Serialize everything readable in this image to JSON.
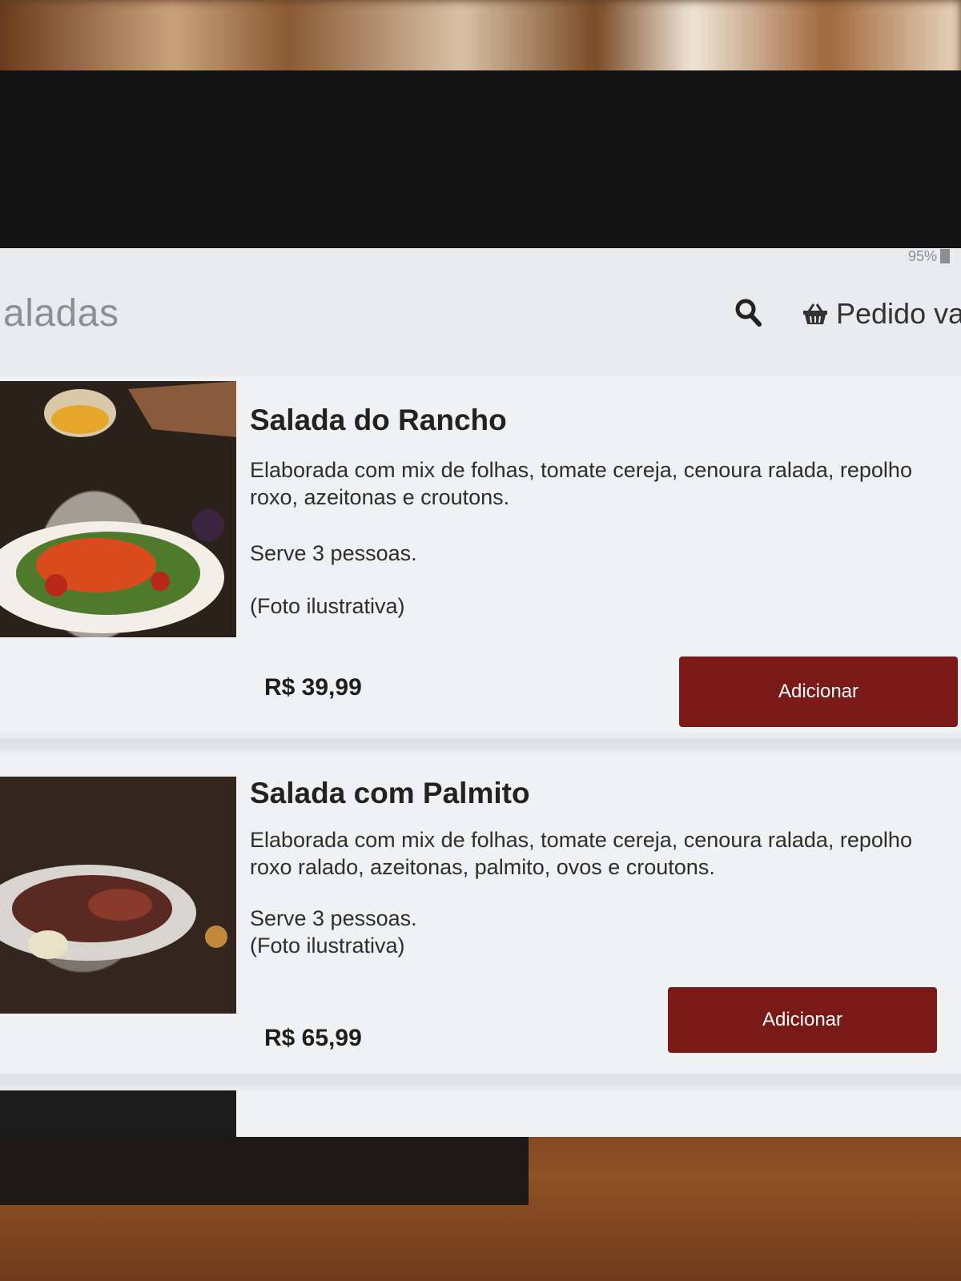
{
  "status": {
    "battery": "95%"
  },
  "appbar": {
    "title": "aladas",
    "order_label": "Pedido va"
  },
  "products": [
    {
      "name": "Salada do Rancho",
      "description": "Elaborada com mix de folhas, tomate cereja, cenoura ralada, repolho roxo, azeitonas e croutons.",
      "serves": "Serve 3 pessoas.",
      "note": "(Foto ilustrativa)",
      "price": "R$ 39,99",
      "button_label": "Adicionar"
    },
    {
      "name": "Salada com Palmito",
      "description": "Elaborada com mix de folhas, tomate cereja, cenoura ralada, repolho roxo ralado, azeitonas, palmito, ovos e croutons.",
      "serves": "Serve 3 pessoas.",
      "note": "(Foto ilustrativa)",
      "price": "R$ 65,99",
      "button_label": "Adicionar"
    }
  ],
  "colors": {
    "accent": "#7a1a16",
    "screen_bg": "#e9ebec"
  },
  "icons": {
    "search": "search-icon",
    "basket": "basket-icon"
  }
}
